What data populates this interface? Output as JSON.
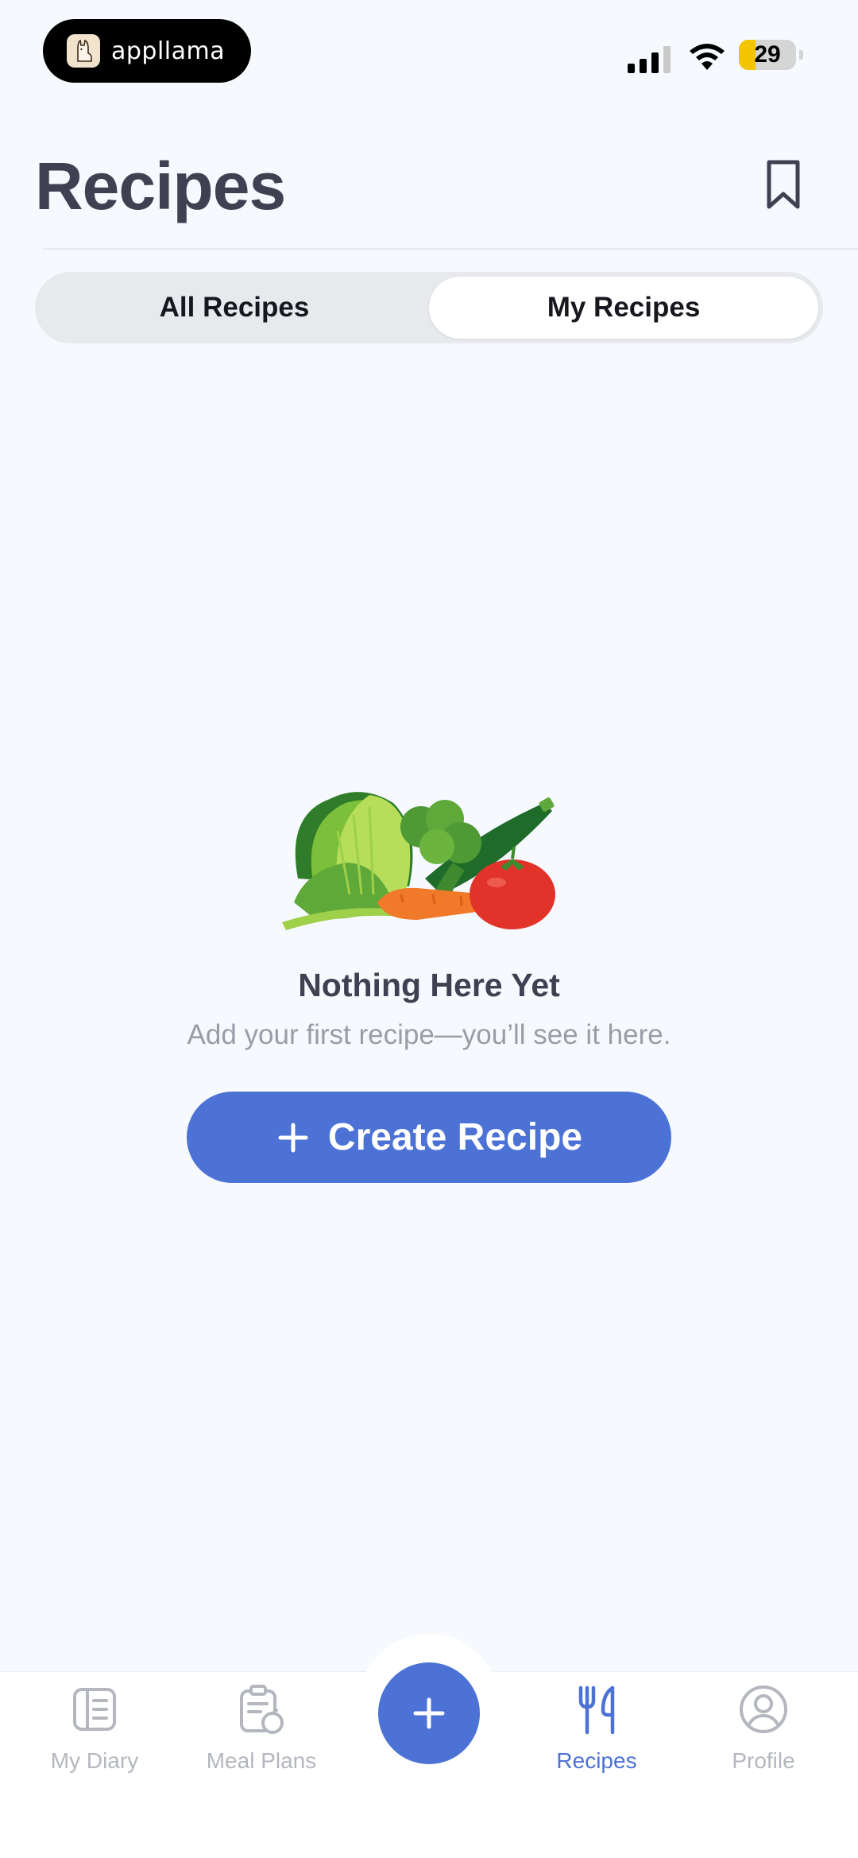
{
  "status_bar": {
    "brand": "appllama",
    "battery_level": "29",
    "battery_fill_percent": 29
  },
  "header": {
    "title": "Recipes",
    "bookmark_icon": "bookmark-icon"
  },
  "tabs": [
    {
      "label": "All Recipes",
      "active": false
    },
    {
      "label": "My Recipes",
      "active": true
    }
  ],
  "empty_state": {
    "illustration": "vegetables-illustration",
    "title": "Nothing Here Yet",
    "subtitle": "Add your first recipe—you’ll see it here.",
    "button_label": "Create Recipe",
    "button_icon": "plus-icon"
  },
  "bottom_nav": {
    "items": [
      {
        "label": "My Diary",
        "icon": "diary-icon",
        "active": false
      },
      {
        "label": "Meal Plans",
        "icon": "meal-plan-icon",
        "active": false
      },
      {
        "label": "Recipes",
        "icon": "fork-knife-icon",
        "active": true
      },
      {
        "label": "Profile",
        "icon": "profile-icon",
        "active": false
      }
    ],
    "fab_icon": "plus-icon"
  },
  "colors": {
    "accent": "#4c72d6",
    "background": "#f6f9fd",
    "title": "#3f4152",
    "inactive_nav": "#b4b7bf"
  }
}
